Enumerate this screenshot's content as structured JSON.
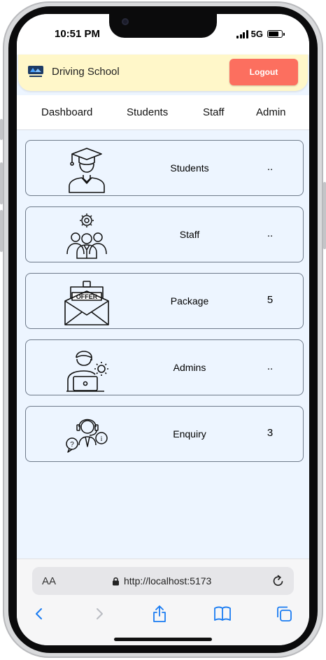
{
  "status": {
    "time": "10:51 PM",
    "network": "5G"
  },
  "header": {
    "brand": "Driving School",
    "logout_label": "Logout"
  },
  "nav": [
    "Dashboard",
    "Students",
    "Staff",
    "Admin"
  ],
  "cards": [
    {
      "label": "Students",
      "count": "..",
      "icon": "graduate-icon"
    },
    {
      "label": "Staff",
      "count": "..",
      "icon": "staff-group-icon"
    },
    {
      "label": "Package",
      "count": "5",
      "icon": "offer-envelope-icon"
    },
    {
      "label": "Admins",
      "count": "..",
      "icon": "admin-laptop-icon"
    },
    {
      "label": "Enquiry",
      "count": "3",
      "icon": "support-agent-icon"
    }
  ],
  "browser": {
    "text_size": "AA",
    "url": "http://localhost:5173"
  },
  "colors": {
    "header_bg": "#fff7c9",
    "logout_bg": "#fc6f5f",
    "page_bg": "#edf5ff",
    "ios_blue": "#1a7cf2"
  }
}
